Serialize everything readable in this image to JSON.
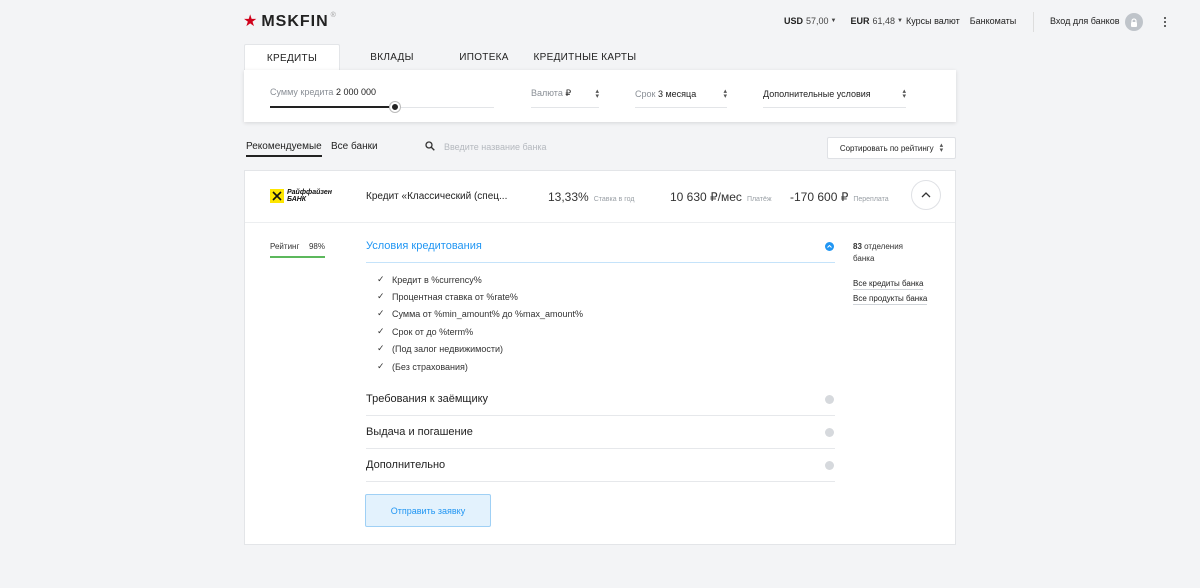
{
  "header": {
    "logo_text": "MSKFIN",
    "logo_reg": "®",
    "rates": [
      {
        "currency": "USD",
        "value": "57,00"
      },
      {
        "currency": "EUR",
        "value": "61,48"
      }
    ],
    "links": [
      "Курсы валют",
      "Банкоматы"
    ],
    "login_label": "Вход для банков"
  },
  "tabs": [
    "КРЕДИТЫ",
    "ВКЛАДЫ",
    "ИПОТЕКА",
    "КРЕДИТНЫЕ КАРТЫ"
  ],
  "filters": {
    "amount_label": "Сумму кредита",
    "amount_value": "2 000 000",
    "amount_slider_fraction": 0.56,
    "currency_label": "Валюта",
    "currency_value": "₽",
    "term_label": "Срок",
    "term_value": "3 месяца",
    "extra_label": "Дополнительные условия"
  },
  "list_controls": {
    "recommended_label": "Рекомендуемые",
    "all_banks_label": "Все банки",
    "search_placeholder": "Введите название банка",
    "sort_label": "Сортировать по рейтингу"
  },
  "offer": {
    "bank_logo_line1": "Райффайзен",
    "bank_logo_line2": "БАНК",
    "credit_name": "Кредит «Классический (спец...",
    "rate_value": "13,33%",
    "rate_label": "Ставка в год",
    "payment_value": "10 630 ₽/мес",
    "payment_label": "Платёж",
    "overpay_value": "-170 600 ₽",
    "overpay_label": "Переплата",
    "rating_label": "Рейтинг",
    "rating_value": "98%",
    "sections": {
      "conditions_title": "Условия кредитования",
      "requirements_title": "Требования к заёмщику",
      "issuance_title": "Выдача и погашение",
      "additional_title": "Дополнительно"
    },
    "conditions": [
      "Кредит в %currency%",
      "Процентная ставка от %rate%",
      "Сумма от %min_amount% до %max_amount%",
      "Срок от до %term%",
      "(Под залог недвижимости)",
      "(Без страхования)"
    ],
    "apply_label": "Отправить заявку",
    "branches_count": "83",
    "branches_label_1": "отделения",
    "branches_label_2": "банка",
    "all_credits_link": "Все кредиты банка",
    "all_products_link": "Все продукты банка"
  },
  "colors": {
    "accent": "#2196f3",
    "brand_star": "#d0021b",
    "rating_bar": "#5cb85c",
    "bank_logo_bg": "#fee600"
  }
}
